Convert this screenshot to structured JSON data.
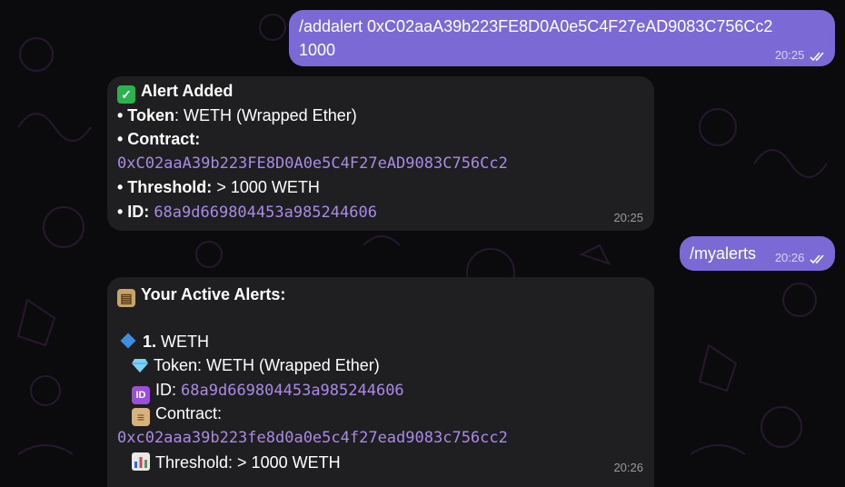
{
  "messages": {
    "m1": {
      "line1": "/addalert 0xC02aaA39b223FE8D0A0e5C4F27eAD9083C756Cc2",
      "line2": "1000",
      "time": "20:25"
    },
    "m2": {
      "check_icon": "check-mark-icon",
      "title": "Alert Added",
      "token_label": "• Token",
      "token_value": ": WETH (Wrapped Ether)",
      "contract_label": "• Contract:",
      "contract_value": "0xC02aaA39b223FE8D0A0e5C4F27eAD9083C756Cc2",
      "threshold_label": "• Threshold:",
      "threshold_value": " > 1000 WETH",
      "id_label": "• ID:",
      "id_value": "68a9d669804453a985244606",
      "time": "20:25"
    },
    "m3": {
      "text": "/myalerts",
      "time": "20:26"
    },
    "m4": {
      "clipboard_icon": "clipboard-icon",
      "title": "Your Active Alerts:",
      "item_number": "1.",
      "item_name": " WETH",
      "token_line": "Token: WETH (Wrapped Ether)",
      "id_label": "ID:",
      "id_value": "68a9d669804453a985244606",
      "contract_label": "Contract:",
      "contract_value": "0xc02aaa39b223fe8d0a0e5c4f27ead9083c756cc2",
      "threshold_line": "Threshold: > 1000 WETH",
      "time": "20:26"
    }
  },
  "colors": {
    "outgoing_bubble": "#7b6ad6",
    "incoming_bubble": "#1f1f21",
    "link_mono": "#a98ae6",
    "background": "#0b0b0d"
  }
}
